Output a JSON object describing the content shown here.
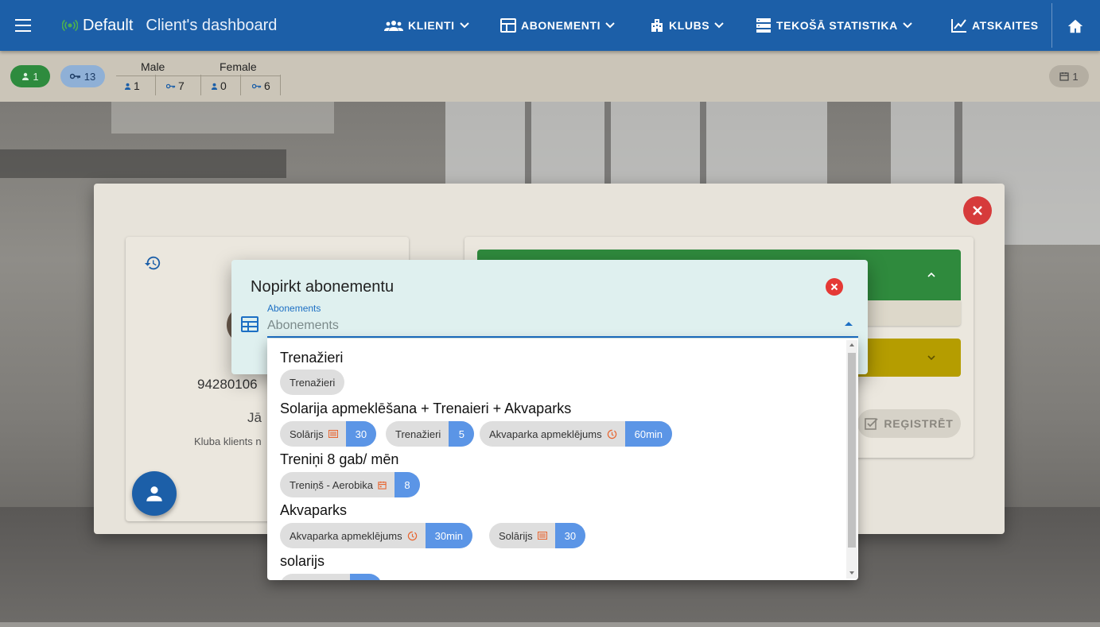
{
  "header": {
    "brand": "Default",
    "page_title": "Client's dashboard",
    "nav": [
      {
        "label": "KLIENTI",
        "icon": "users-icon"
      },
      {
        "label": "ABONEMENTI",
        "icon": "grid-icon"
      },
      {
        "label": "KLUBS",
        "icon": "building-icon"
      },
      {
        "label": "TEKOŠĀ STATISTIKA",
        "icon": "server-icon"
      },
      {
        "label": "ATSKAITES",
        "icon": "chart-icon"
      }
    ],
    "home_icon": "home-icon",
    "accent": "#1c5fa8"
  },
  "stats": {
    "active_clients": "1",
    "active_keys": "13",
    "male_label": "Male",
    "female_label": "Female",
    "male_clients": "1",
    "male_keys": "7",
    "female_clients": "0",
    "female_keys": "6",
    "calendar_count": "1"
  },
  "client": {
    "id_partial": "94280106",
    "name_partial": "Jā",
    "type_partial": "Kluba klients n"
  },
  "register_button": "REĢISTRĒT",
  "dialog": {
    "title": "Nopirkt abonementu",
    "field_label": "Abonements",
    "field_placeholder": "Abonements"
  },
  "options": [
    {
      "title": "Trenažieri",
      "chips": [
        {
          "text": "Trenažieri"
        }
      ]
    },
    {
      "title": "Solarija apmeklēšana + Trenaieri + Akvaparks",
      "chips": [
        {
          "text": "Solārijs",
          "icon": "solarium-icon",
          "count": "30"
        },
        {
          "text": "Trenažieri",
          "count": "5"
        },
        {
          "text": "Akvaparka apmeklējums",
          "icon": "clock-icon",
          "count": "60min"
        }
      ]
    },
    {
      "title": "Treniņi 8 gab/ mēn",
      "chips": [
        {
          "text": "Treniņš - Aerobika",
          "icon": "calendar-icon",
          "count": "8"
        }
      ]
    },
    {
      "title": "Akvaparks",
      "chips": [
        {
          "text": "Akvaparka apmeklējums",
          "icon": "clock-icon",
          "count": "30min"
        },
        {
          "text": "Solārijs",
          "icon": "solarium-icon",
          "count": "30"
        }
      ]
    },
    {
      "title": "solarijs",
      "chips": []
    }
  ]
}
